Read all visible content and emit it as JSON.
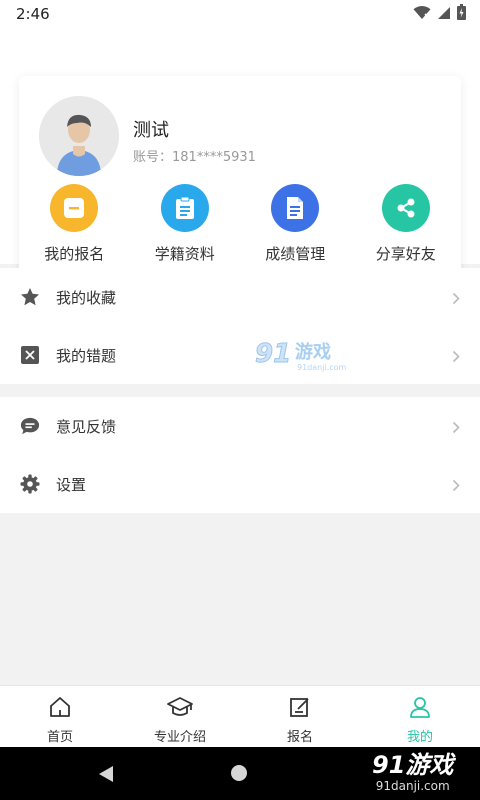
{
  "status_bar": {
    "time": "2:46"
  },
  "profile": {
    "name": "测试",
    "account_label": "账号：",
    "account_value": "181****5931"
  },
  "actions": [
    {
      "label": "我的报名",
      "color": "#f8b62d",
      "icon": "minus-box-icon"
    },
    {
      "label": "学籍资料",
      "color": "#29a8ec",
      "icon": "clipboard-icon"
    },
    {
      "label": "成绩管理",
      "color": "#3d72e6",
      "icon": "document-icon"
    },
    {
      "label": "分享好友",
      "color": "#26c6a5",
      "icon": "share-icon"
    }
  ],
  "menu": {
    "favorites": "我的收藏",
    "mistakes": "我的错题",
    "feedback": "意见反馈",
    "settings": "设置"
  },
  "watermark": {
    "brand": "91游戏",
    "domain": "91danji.com"
  },
  "bottom_nav": [
    {
      "label": "首页",
      "icon": "home-icon"
    },
    {
      "label": "专业介绍",
      "icon": "graduation-cap-icon"
    },
    {
      "label": "报名",
      "icon": "edit-icon"
    },
    {
      "label": "我的",
      "icon": "user-icon",
      "active": true
    }
  ],
  "colors": {
    "accent": "#26c6a5",
    "brand_yellow": "#f8b62d",
    "brand_blue": "#29a8ec",
    "brand_indigo": "#3d72e6"
  }
}
